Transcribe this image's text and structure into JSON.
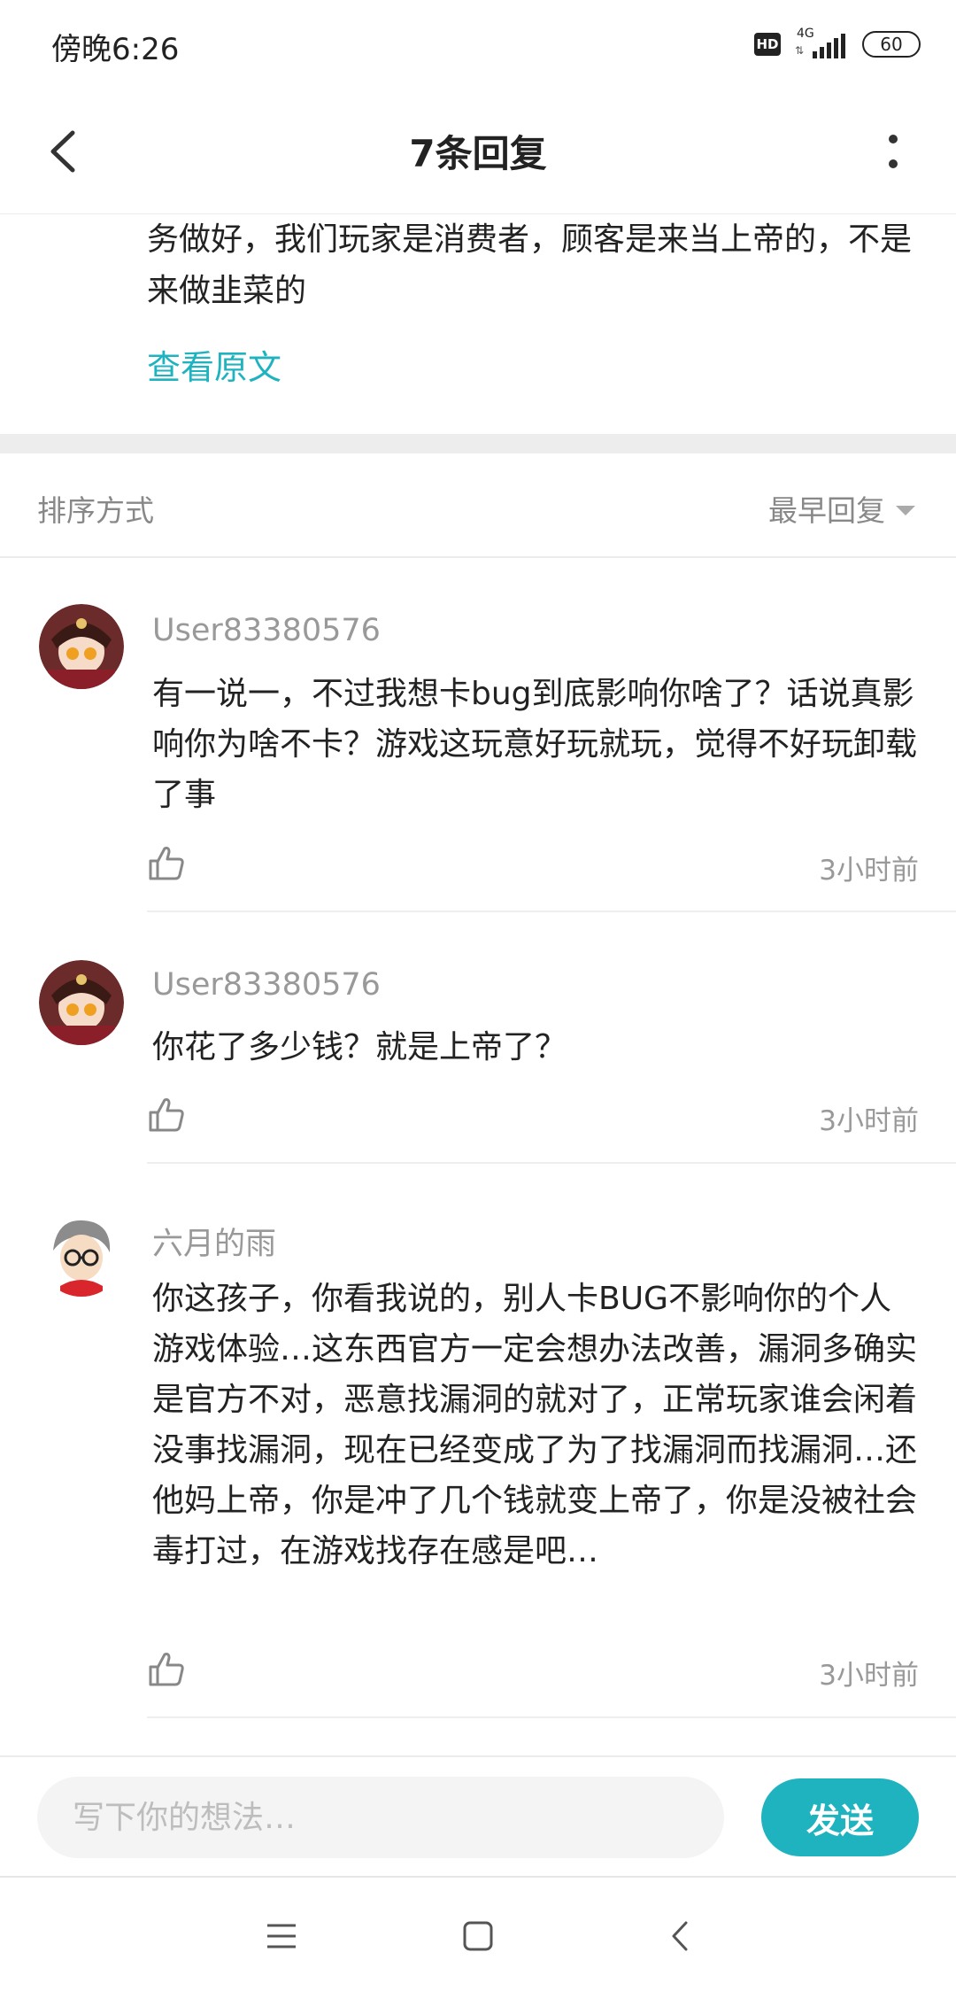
{
  "status_bar": {
    "time": "傍晚6:26",
    "hd_label": "HD",
    "network": "4G",
    "battery": "60"
  },
  "header": {
    "title": "7条回复"
  },
  "original_post": {
    "text": "务做好，我们玩家是消费者，顾客是来当上帝的，不是来做韭菜的",
    "view_original_label": "查看原文"
  },
  "sort": {
    "label": "排序方式",
    "selected": "最早回复"
  },
  "comments": [
    {
      "user": "User83380576",
      "text": "有一说一，不过我想卡bug到底影响你啥了？话说真影响你为啥不卡？游戏这玩意好玩就玩，觉得不好玩卸载了事",
      "time": "3小时前"
    },
    {
      "user": "User83380576",
      "text": "你花了多少钱？就是上帝了？",
      "time": "3小时前"
    },
    {
      "user": "六月的雨",
      "text": "你这孩子，你看我说的，别人卡BUG不影响你的个人游戏体验…这东西官方一定会想办法改善，漏洞多确实是官方不对，恶意找漏洞的就对了，正常玩家谁会闲着没事找漏洞，现在已经变成了为了找漏洞而找漏洞…还他妈上帝，你是冲了几个钱就变上帝了，你是没被社会毒打过，在游戏找存在感是吧…",
      "time": "3小时前"
    }
  ],
  "input": {
    "placeholder": "写下你的想法…",
    "value": "",
    "send_label": "发送"
  },
  "colors": {
    "accent": "#1fb3bf",
    "muted_text": "#999999",
    "divider": "#ededed"
  },
  "icons": {
    "back": "chevron-left-icon",
    "more": "more-vertical-icon",
    "like": "thumbs-up-icon",
    "sort_caret": "caret-down-icon",
    "sys_menu": "menu-icon",
    "sys_home": "home-square-icon",
    "sys_back": "back-icon"
  }
}
